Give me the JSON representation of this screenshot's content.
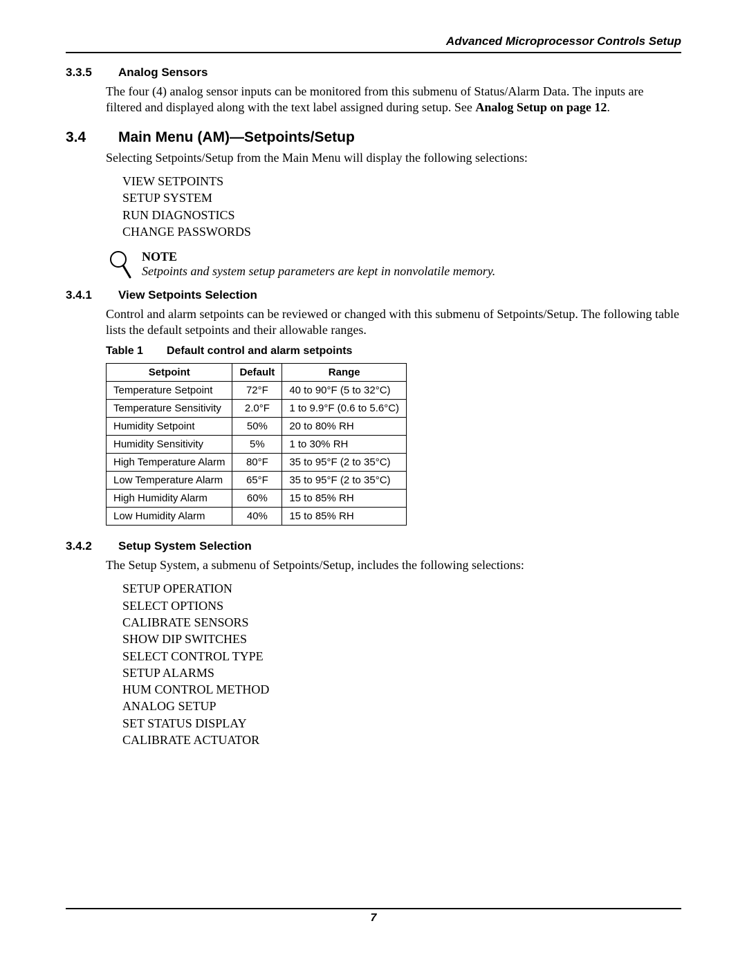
{
  "header": {
    "running_title": "Advanced Microprocessor Controls Setup"
  },
  "s335": {
    "num": "3.3.5",
    "title": "Analog Sensors",
    "body_a": "The four (4) analog sensor inputs can be monitored from this submenu of Status/Alarm Data. The inputs are filtered and displayed along with the text label assigned during setup. See ",
    "body_bold": "Analog Setup on page 12",
    "body_b": "."
  },
  "s34": {
    "num": "3.4",
    "title": "Main Menu (AM)—Setpoints/Setup",
    "intro": "Selecting Setpoints/Setup from the Main Menu will display the following selections:",
    "items": [
      "VIEW SETPOINTS",
      "SETUP SYSTEM",
      "RUN DIAGNOSTICS",
      "CHANGE PASSWORDS"
    ]
  },
  "note": {
    "label": "NOTE",
    "body": "Setpoints and system setup parameters are kept in nonvolatile memory."
  },
  "s341": {
    "num": "3.4.1",
    "title": "View Setpoints Selection",
    "body": "Control and alarm setpoints can be reviewed or changed with this submenu of Setpoints/Setup. The following table lists the default setpoints and their allowable ranges."
  },
  "table1": {
    "label": "Table 1",
    "caption": "Default control and alarm setpoints",
    "headers": [
      "Setpoint",
      "Default",
      "Range"
    ],
    "rows": [
      {
        "setpoint": "Temperature Setpoint",
        "default": "72°F",
        "range": "40 to 90°F (5 to 32°C)"
      },
      {
        "setpoint": "Temperature Sensitivity",
        "default": "2.0°F",
        "range": "1 to 9.9°F (0.6 to 5.6°C)"
      },
      {
        "setpoint": "Humidity Setpoint",
        "default": "50%",
        "range": "20 to 80% RH"
      },
      {
        "setpoint": "Humidity Sensitivity",
        "default": "5%",
        "range": "1 to 30% RH"
      },
      {
        "setpoint": "High Temperature Alarm",
        "default": "80°F",
        "range": "35 to 95°F (2 to 35°C)"
      },
      {
        "setpoint": "Low Temperature Alarm",
        "default": "65°F",
        "range": "35 to 95°F (2 to 35°C)"
      },
      {
        "setpoint": "High Humidity Alarm",
        "default": "60%",
        "range": "15 to 85% RH"
      },
      {
        "setpoint": "Low Humidity Alarm",
        "default": "40%",
        "range": "15 to 85% RH"
      }
    ]
  },
  "s342": {
    "num": "3.4.2",
    "title": "Setup System Selection",
    "body": "The Setup System, a submenu of Setpoints/Setup, includes the following selections:",
    "items": [
      "SETUP OPERATION",
      "SELECT OPTIONS",
      "CALIBRATE SENSORS",
      "SHOW DIP SWITCHES",
      "SELECT CONTROL TYPE",
      "SETUP ALARMS",
      "HUM CONTROL METHOD",
      "ANALOG SETUP",
      "SET STATUS DISPLAY",
      "CALIBRATE ACTUATOR"
    ]
  },
  "footer": {
    "page_number": "7"
  }
}
